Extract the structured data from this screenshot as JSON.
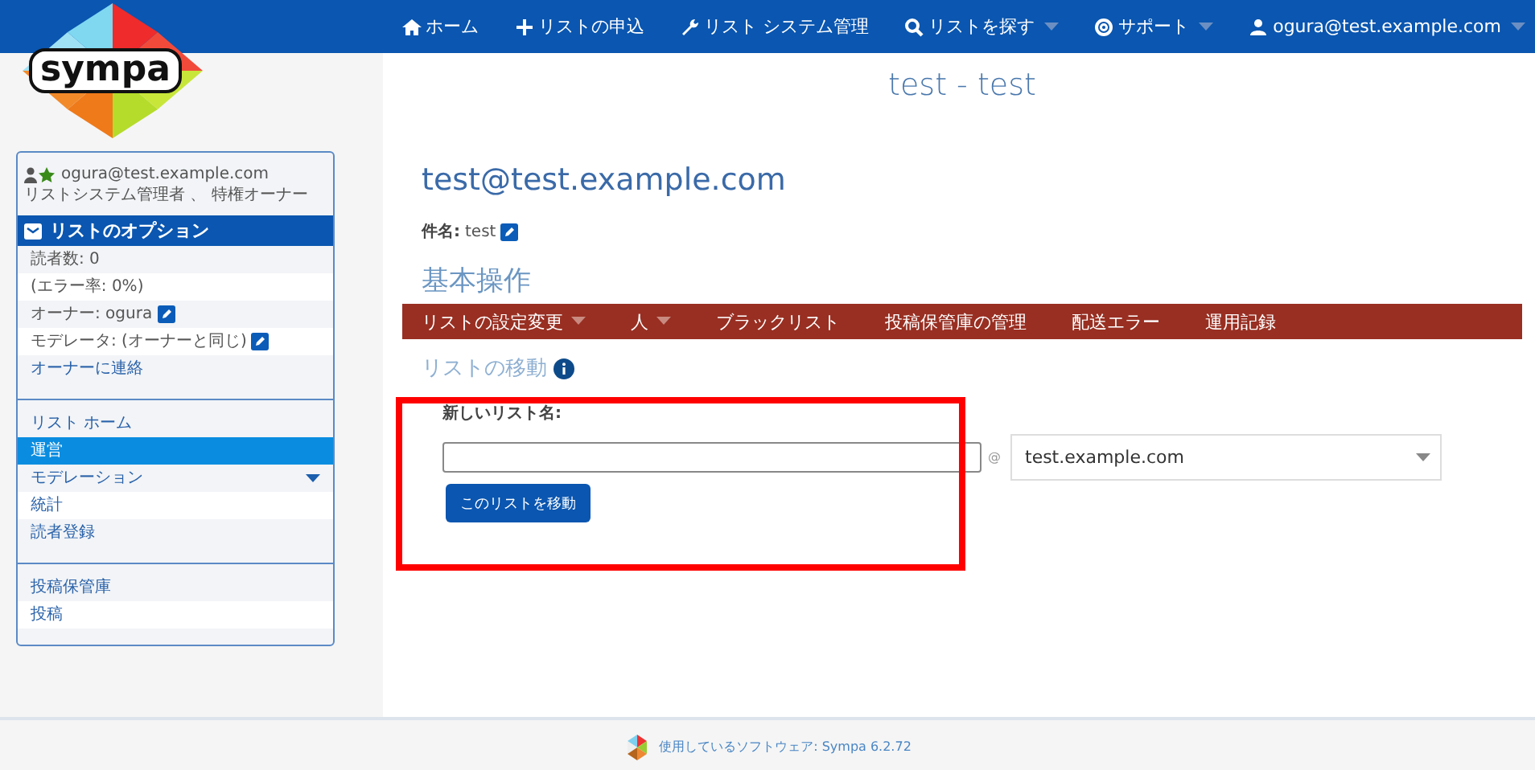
{
  "logo": {
    "text": "sympa"
  },
  "nav": [
    {
      "label": "ホーム",
      "has_menu": false
    },
    {
      "label": "リストの申込",
      "has_menu": false
    },
    {
      "label": "リスト システム管理",
      "has_menu": false
    },
    {
      "label": "リストを探す",
      "has_menu": true
    },
    {
      "label": "サポート",
      "has_menu": true
    },
    {
      "label": "ogura@test.example.com",
      "has_menu": true
    }
  ],
  "page_title": "test - test",
  "sidebar": {
    "user_email": "ogura@test.example.com",
    "user_roles": "リストシステム管理者 、 特権オーナー",
    "options_title": "リストのオプション",
    "info": [
      {
        "label": "読者数: 0",
        "editable": false,
        "kind": "text"
      },
      {
        "label": "(エラー率: 0%)",
        "editable": false,
        "kind": "text"
      },
      {
        "label": "オーナー: ogura",
        "editable": true,
        "kind": "text"
      },
      {
        "label": "モデレータ: (オーナーと同じ)",
        "editable": true,
        "kind": "text"
      },
      {
        "label": "オーナーに連絡",
        "editable": false,
        "kind": "link"
      }
    ],
    "menu": [
      {
        "label": "リスト ホーム",
        "selected": false,
        "expandable": false
      },
      {
        "label": "運営",
        "selected": true,
        "expandable": false
      },
      {
        "label": "モデレーション",
        "selected": false,
        "expandable": true
      },
      {
        "label": "統計",
        "selected": false,
        "expandable": false
      },
      {
        "label": "読者登録",
        "selected": false,
        "expandable": false
      }
    ],
    "archive_menu": [
      {
        "label": "投稿保管庫",
        "selected": false
      },
      {
        "label": "投稿",
        "selected": false
      }
    ]
  },
  "list_address": "test@test.example.com",
  "subject": {
    "label": "件名:",
    "value": "test"
  },
  "section_title": "基本操作",
  "tabs": [
    {
      "label": "リストの設定変更",
      "has_menu": true
    },
    {
      "label": "人",
      "has_menu": true
    },
    {
      "label": "ブラックリスト",
      "has_menu": false
    },
    {
      "label": "投稿保管庫の管理",
      "has_menu": false
    },
    {
      "label": "配送エラー",
      "has_menu": false
    },
    {
      "label": "運用記録",
      "has_menu": false
    }
  ],
  "move": {
    "title": "リストの移動",
    "name_label": "新しいリスト名:",
    "at": "@",
    "domain": "test.example.com",
    "button": "このリストを移動"
  },
  "footer": {
    "text": "使用しているソフトウェア: Sympa 6.2.72"
  }
}
